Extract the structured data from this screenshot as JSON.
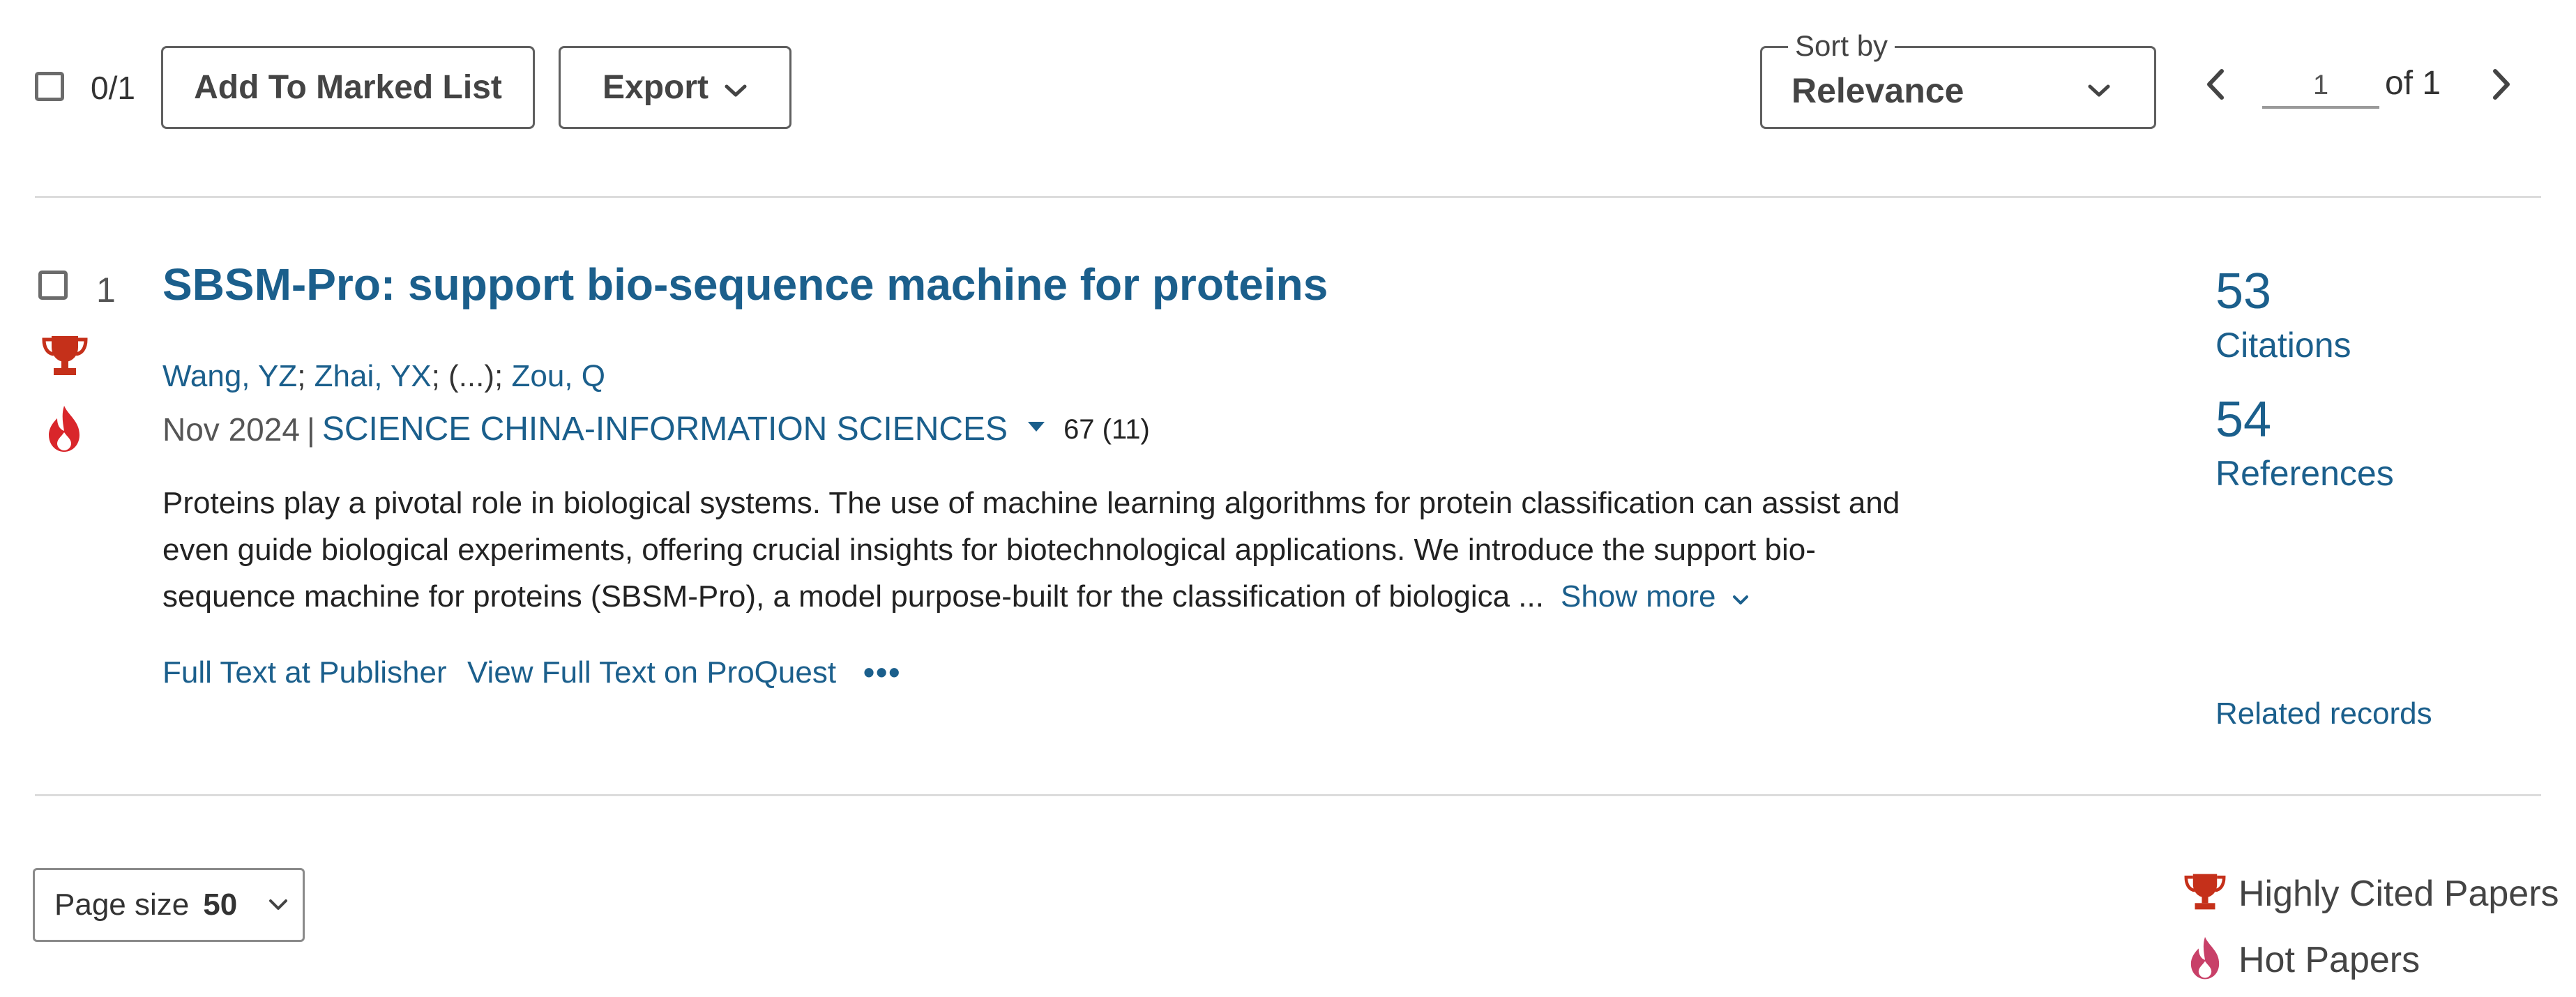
{
  "toolbar": {
    "selection_count": "0/1",
    "add_to_marked_list_label": "Add To Marked List",
    "export_label": "Export",
    "sort_by_label": "Sort by",
    "sort_value": "Relevance",
    "current_page": "1",
    "of_total_label": "of 1"
  },
  "record": {
    "index": "1",
    "title": "SBSM-Pro: support bio-sequence machine for proteins",
    "authors": [
      {
        "name": "Wang, YZ",
        "link": true
      },
      {
        "name": "Zhai, YX",
        "link": true
      },
      {
        "name": "(...)",
        "link": false
      },
      {
        "name": "Zou, Q",
        "link": true
      }
    ],
    "date": "Nov 2024",
    "separator": "|",
    "journal": "SCIENCE CHINA-INFORMATION SCIENCES",
    "jcr": "67 (11)",
    "abstract_lines": [
      "Proteins play a pivotal role in biological systems. The use of machine learning algorithms for protein classification can assist and",
      "even guide biological experiments, offering crucial insights for biotechnological applications. We introduce the support bio-",
      "sequence machine for proteins (SBSM-Pro), a model purpose-built for the classification of biologica ..."
    ],
    "show_more_label": "Show more",
    "full_text_publisher_label": "Full Text at Publisher",
    "full_text_proquest_label": "View Full Text on ProQuest",
    "more_options_label": "•••",
    "citations_count": "53",
    "citations_label": "Citations",
    "references_count": "54",
    "references_label": "References",
    "related_records_label": "Related records",
    "badges": [
      "trophy-icon",
      "flame-icon"
    ]
  },
  "footer": {
    "page_size_label": "Page size",
    "page_size_value": "50",
    "legend": [
      {
        "icon": "trophy-icon",
        "label": "Highly Cited Papers"
      },
      {
        "icon": "flame-icon",
        "label": "Hot Papers"
      }
    ]
  },
  "colors": {
    "link_blue": "#1b5f8c",
    "trophy_red": "#c5301a",
    "hot_red": "#d9262b",
    "hot_pink": "#c84068",
    "divider": "#dcdcdc"
  }
}
